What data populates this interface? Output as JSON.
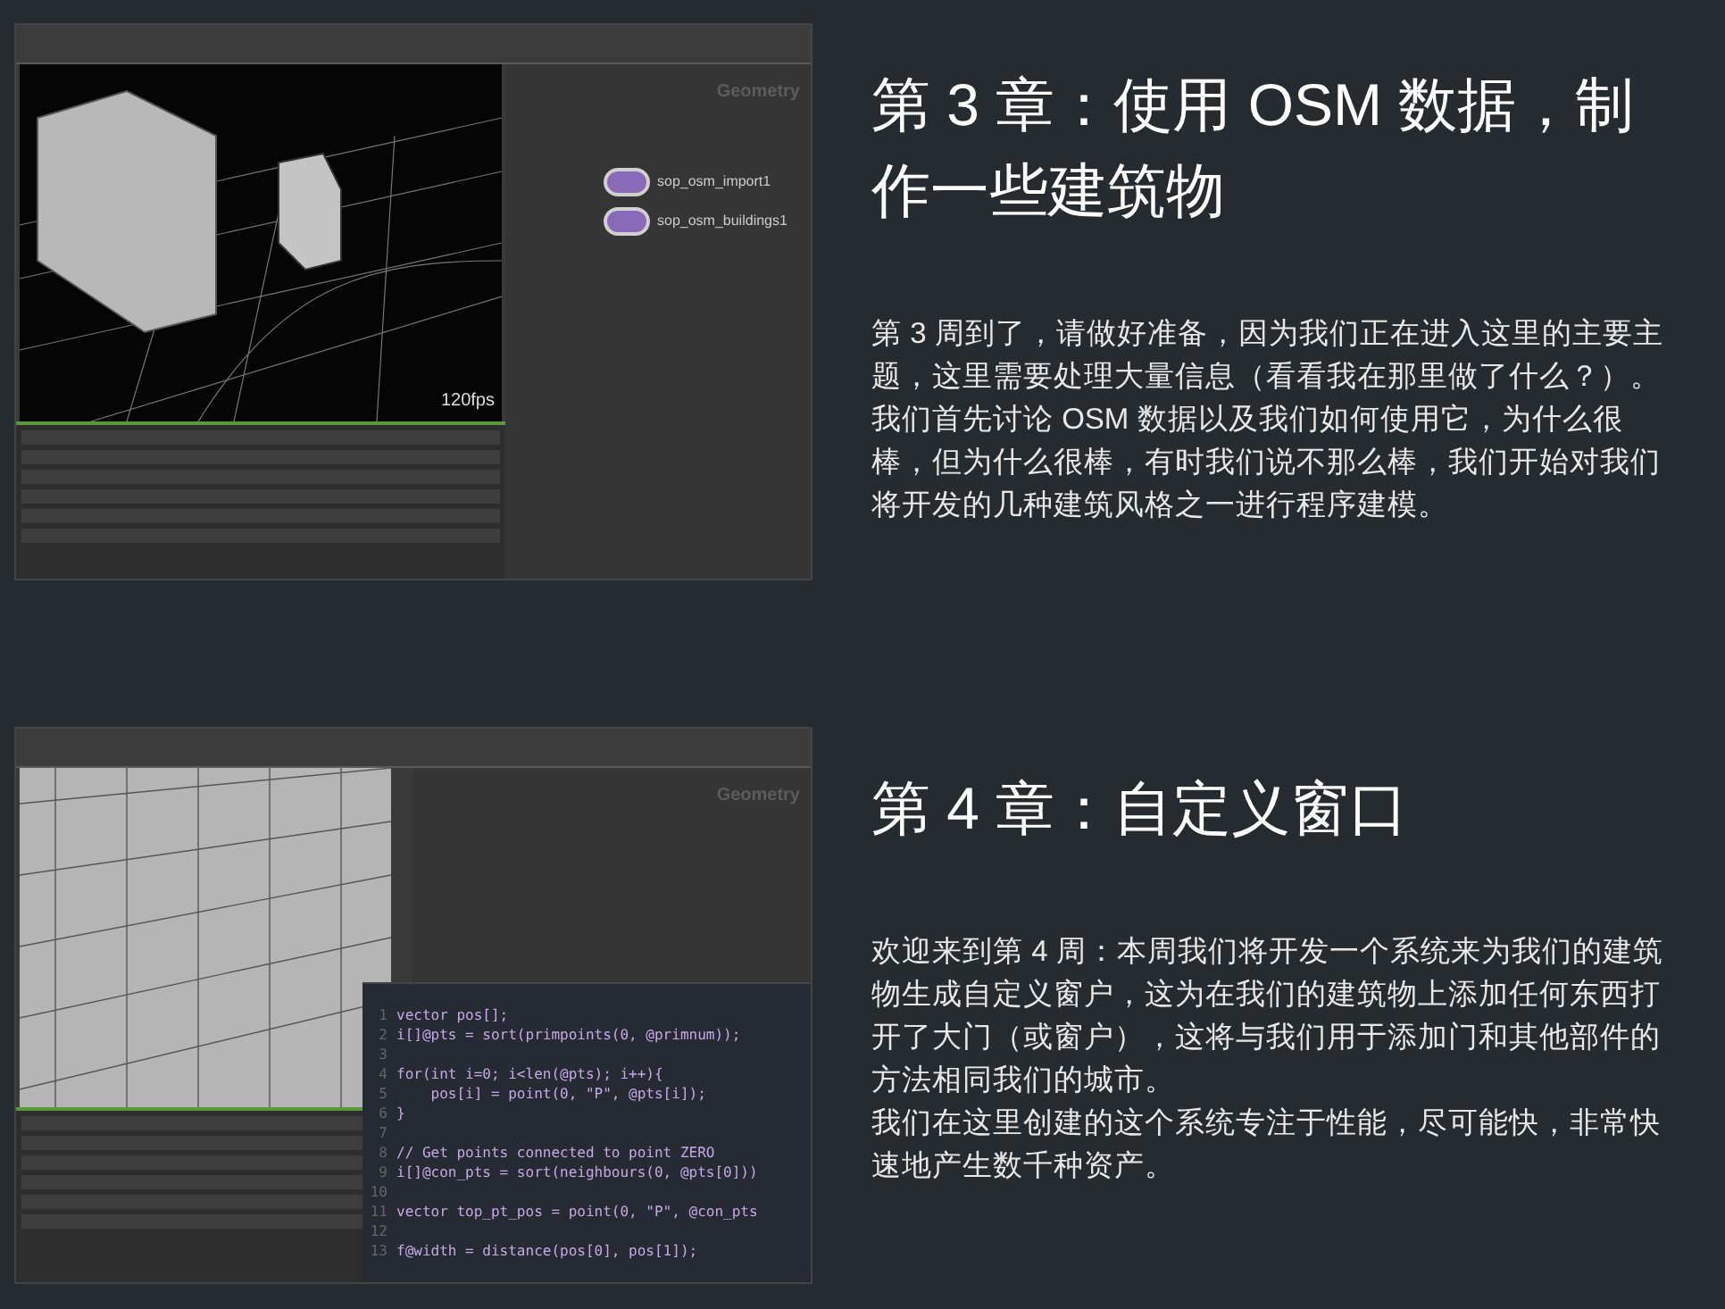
{
  "chapters": [
    {
      "title": "第 3 章：使用 OSM 数据，制作一些建筑物",
      "paragraphs": [
        "第 3 周到了，请做好准备，因为我们正在进入这里的主要主题，这里需要处理大量信息（看看我在那里做了什么？）。我们首先讨论 OSM 数据以及我们如何使用它，为什么很棒，但为什么很棒，有时我们说不那么棒，我们开始对我们将开发的几种建筑风格之一进行程序建模。"
      ],
      "screenshot": {
        "kind": "network",
        "panel_title": "Geometry",
        "viewport_reading": "120fps",
        "nodes": [
          "sop_osm_import1",
          "sop_osm_buildings1"
        ]
      }
    },
    {
      "title": "第 4 章：自定义窗口",
      "paragraphs": [
        "欢迎来到第 4 周：本周我们将开发一个系统来为我们的建筑物生成自定义窗户，这为在我们的建筑物上添加任何东西打开了大门（或窗户），这将与我们用于添加门和其他部件的方法相同我们的城市。",
        "我们在这里创建的这个系统专注于性能，尽可能快，非常快速地产生数千种资产。"
      ],
      "screenshot": {
        "kind": "code",
        "panel_title": "Geometry",
        "code_lines": [
          {
            "number": "1",
            "code": "vector pos[];"
          },
          {
            "number": "2",
            "code": "i[]@pts = sort(primpoints(0, @primnum));"
          },
          {
            "number": "3"
          },
          {
            "number": "4",
            "code": "for(int i=0; i<len(@pts); i++){"
          },
          {
            "number": "5",
            "code": "    pos[i] = point(0, \"P\", @pts[i]);"
          },
          {
            "number": "6",
            "code": "}"
          },
          {
            "number": "7"
          },
          {
            "number": "8",
            "code": "// Get points connected to point ZERO"
          },
          {
            "number": "9",
            "code": "i[]@con_pts = sort(neighbours(0, @pts[0]))"
          },
          {
            "number": "10"
          },
          {
            "number": "11",
            "code": "vector top_pt_pos = point(0, \"P\", @con_pts"
          },
          {
            "number": "12"
          },
          {
            "number": "13",
            "code": "f@width = distance(pos[0], pos[1]);"
          }
        ]
      }
    }
  ]
}
